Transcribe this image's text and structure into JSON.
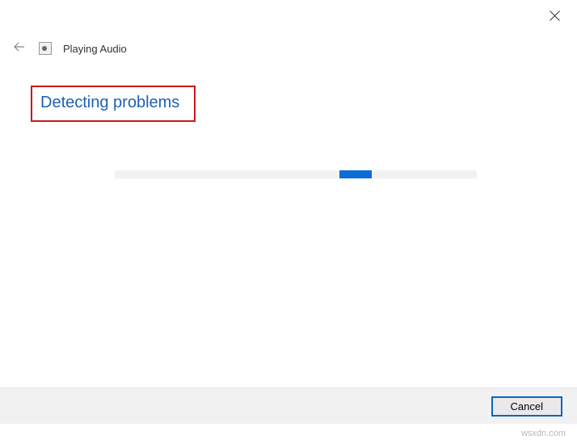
{
  "header": {
    "title": "Playing Audio"
  },
  "main": {
    "status_heading": "Detecting problems"
  },
  "footer": {
    "cancel_label": "Cancel"
  },
  "watermark": "wsxdn.com"
}
